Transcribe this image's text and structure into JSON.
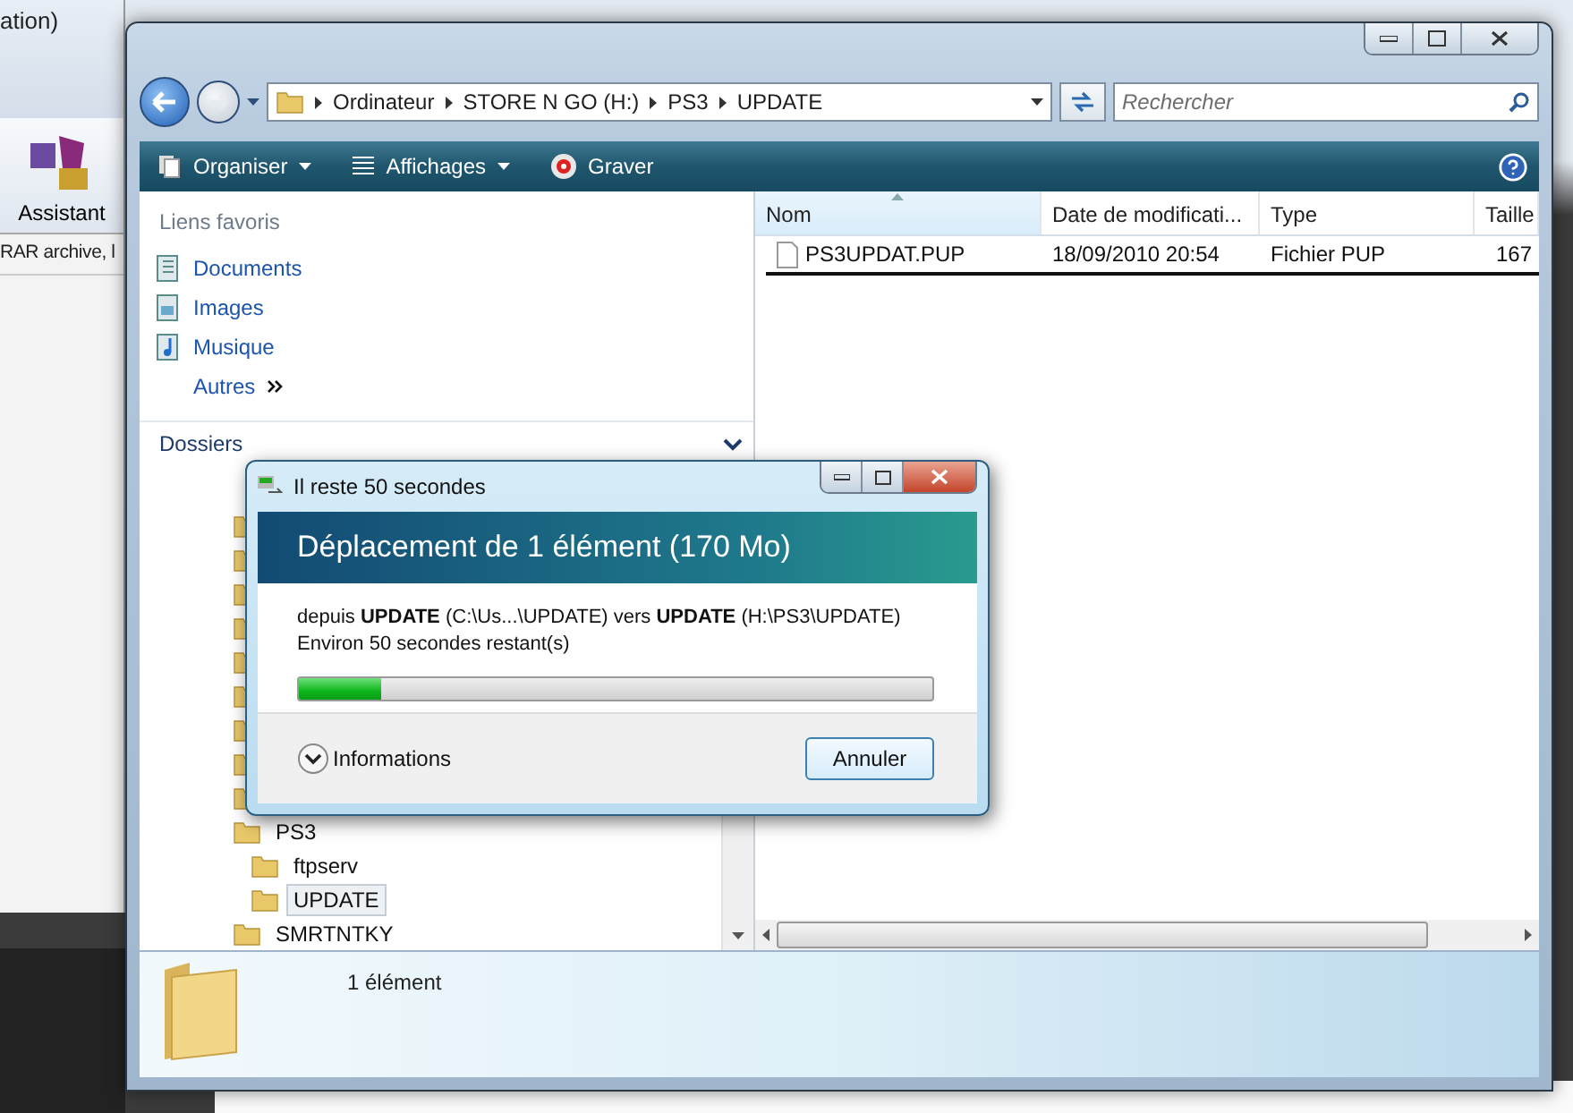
{
  "background_window": {
    "title_fragment": "ation)",
    "toolbar_button": "Assistant",
    "list_text": "RAR archive, l"
  },
  "explorer": {
    "breadcrumb": [
      "Ordinateur",
      "STORE N GO (H:)",
      "PS3",
      "UPDATE"
    ],
    "search": {
      "placeholder": "Rechercher"
    },
    "toolbar": [
      {
        "label": "Organiser",
        "kind": "organize"
      },
      {
        "label": "Affichages",
        "kind": "views"
      },
      {
        "label": "Graver",
        "kind": "burn"
      }
    ],
    "favorites": {
      "title": "Liens favoris",
      "items": [
        {
          "label": "Documents",
          "kind": "documents"
        },
        {
          "label": "Images",
          "kind": "images"
        },
        {
          "label": "Musique",
          "kind": "music"
        },
        {
          "label": "Autres",
          "kind": "more"
        }
      ]
    },
    "folders": {
      "title": "Dossiers",
      "expanded": true,
      "items": [
        {
          "label": "PS3",
          "selected": false,
          "children": [
            {
              "label": "ftpserv",
              "selected": false
            },
            {
              "label": "UPDATE",
              "selected": true
            }
          ]
        },
        {
          "label": "SMRTNTKY",
          "selected": false
        }
      ]
    },
    "table": {
      "columns": [
        {
          "label": "Nom",
          "sorted": true
        },
        {
          "label": "Date de modificati...",
          "sorted": false
        },
        {
          "label": "Type",
          "sorted": false
        },
        {
          "label": "Taille",
          "sorted": false
        }
      ],
      "rows": [
        {
          "cells": [
            "PS3UPDAT.PUP",
            "18/09/2010 20:54",
            "Fichier PUP",
            "167"
          ]
        }
      ]
    },
    "details": {
      "summary": "1 élément"
    }
  },
  "dialog": {
    "title": "Il reste 50 secondes",
    "heading": "Déplacement de 1 élément (170 Mo)",
    "detail": "depuis **UPDATE** (C:\\Us...\\UPDATE) vers **UPDATE** (H:\\PS3\\UPDATE)",
    "remaining": "Environ 50 secondes restant(s)",
    "progress": {
      "level": 0.13
    },
    "expander": {
      "label": "Informations",
      "expanded": false
    },
    "buttons": [
      {
        "label": "Annuler"
      }
    ]
  }
}
